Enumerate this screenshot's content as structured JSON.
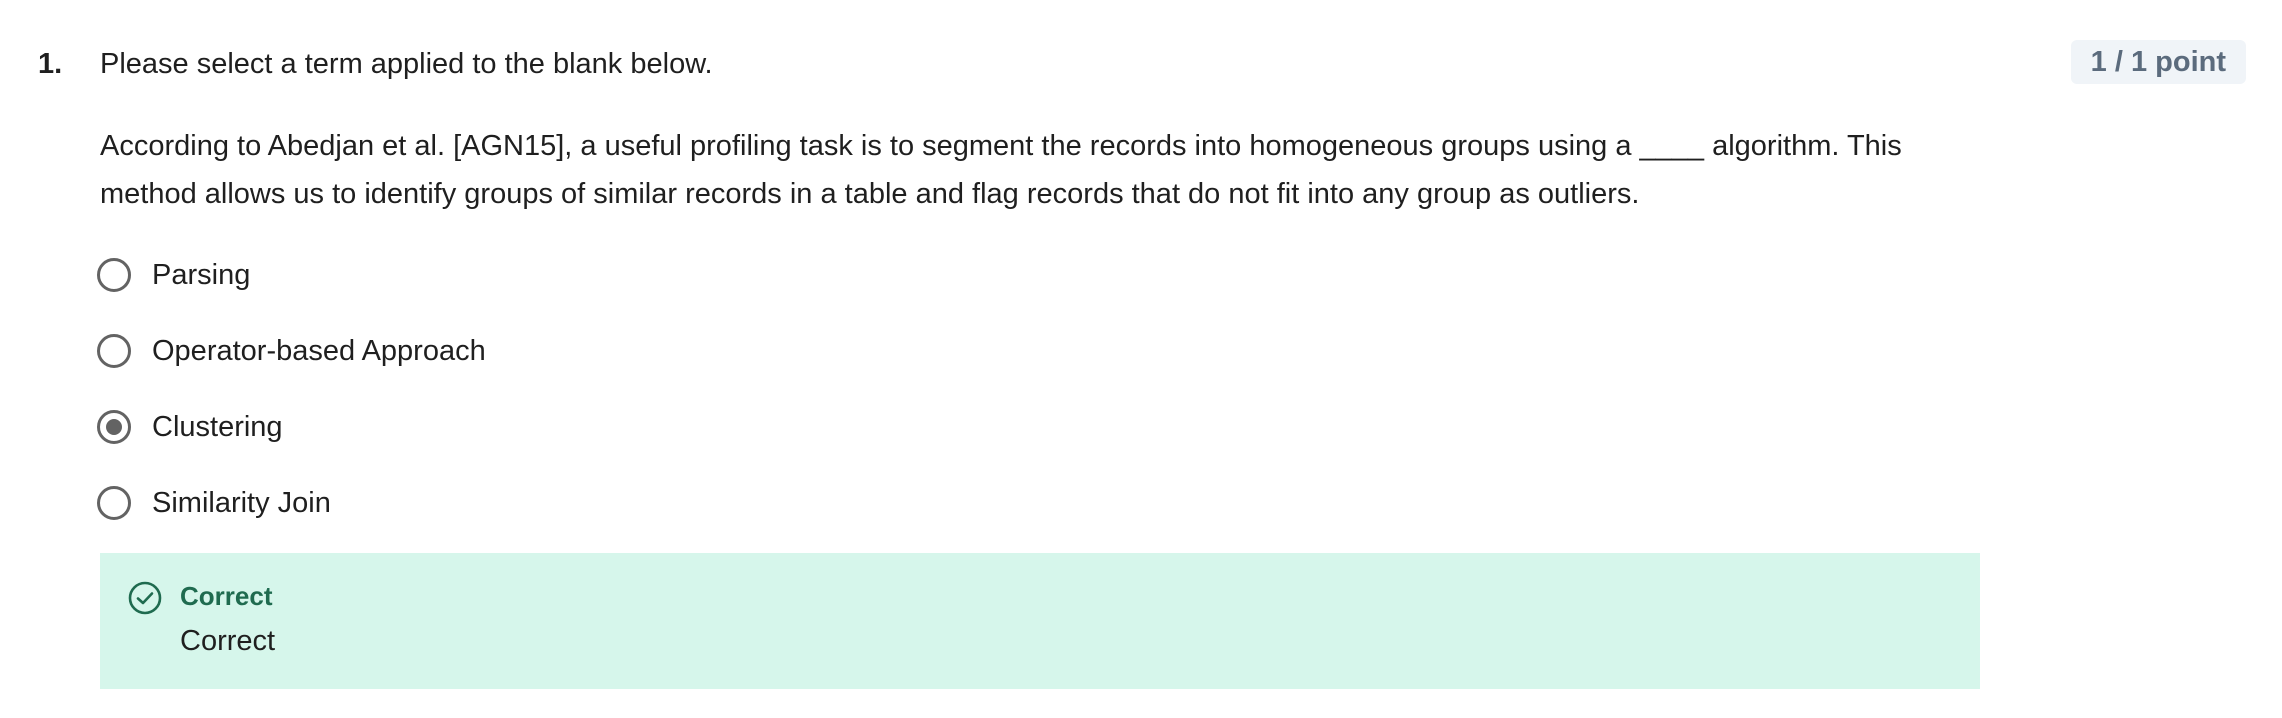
{
  "question": {
    "number": "1.",
    "prompt": "Please select a term applied to the blank below.",
    "points": "1 / 1 point",
    "body": "According to Abedjan et al. [AGN15], a useful profiling task is to segment the records into homogeneous groups using a ____ algorithm. This method allows us to identify groups of similar records in a table and flag records that do not fit into any group as outliers.",
    "options": [
      {
        "label": "Parsing",
        "selected": false
      },
      {
        "label": "Operator-based Approach",
        "selected": false
      },
      {
        "label": "Clustering",
        "selected": true
      },
      {
        "label": "Similarity Join",
        "selected": false
      }
    ]
  },
  "feedback": {
    "icon": "check-circle-icon",
    "title": "Correct",
    "text": "Correct",
    "background_color": "#d6f6eb",
    "accent_color": "#1f6b4f"
  }
}
